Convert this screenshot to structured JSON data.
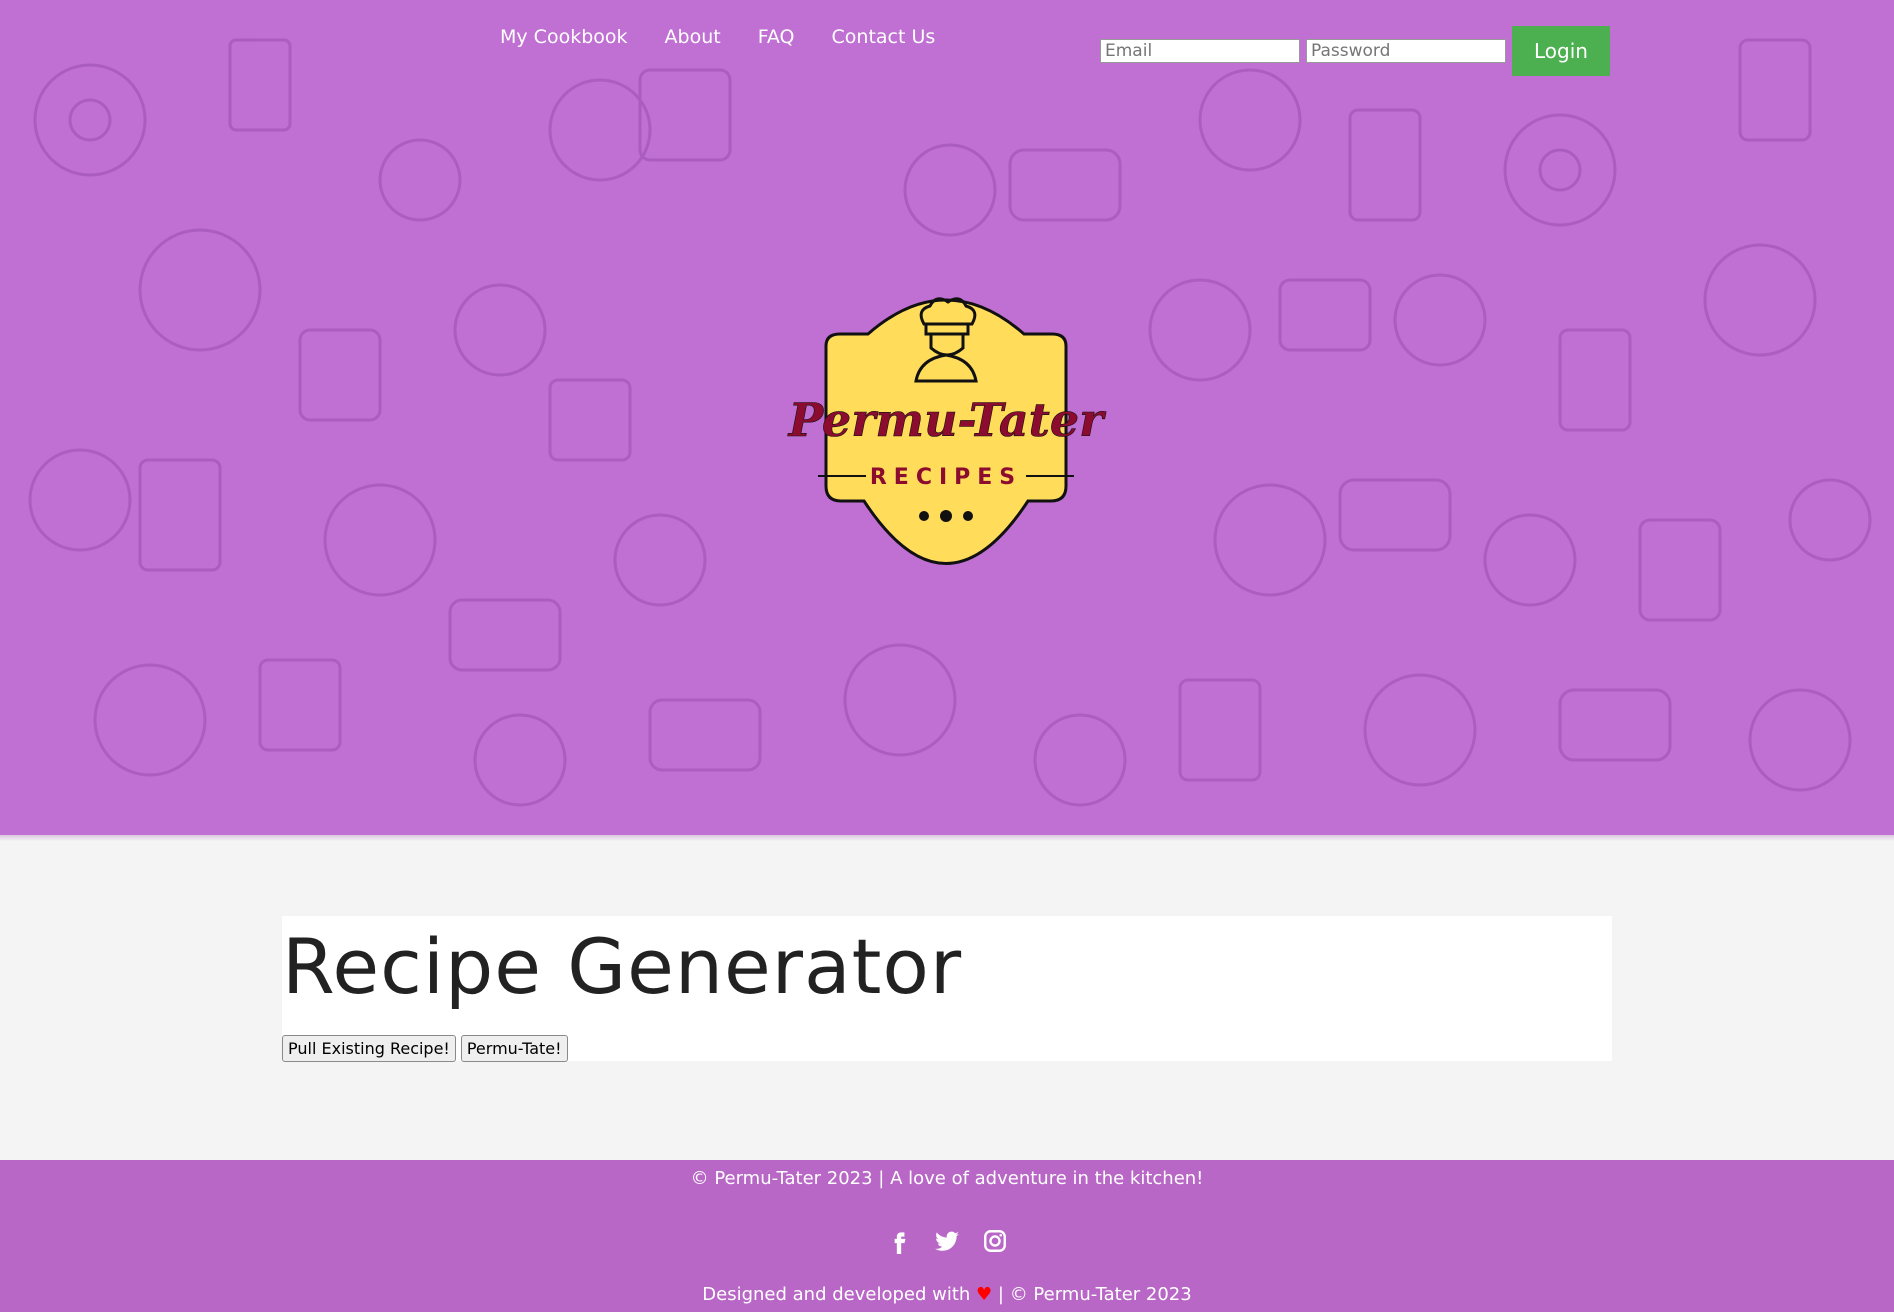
{
  "nav": {
    "items": [
      "My Cookbook",
      "About",
      "FAQ",
      "Contact Us"
    ]
  },
  "login": {
    "email_placeholder": "Email",
    "password_placeholder": "Password",
    "button_label": "Login"
  },
  "logo": {
    "brand": "Permu-Tater",
    "tagline": "RECIPES"
  },
  "main": {
    "title": "Recipe Generator",
    "buttons": [
      "Pull Existing Recipe!",
      "Permu-Tate!"
    ]
  },
  "footer": {
    "copyright": "© Permu-Tater 2023 | A love of adventure in the kitchen!",
    "credit_prefix": "Designed and developed with",
    "credit_heart": "♥",
    "credit_suffix": "| © Permu-Tater 2023",
    "social_icons": [
      "facebook-icon",
      "twitter-icon",
      "instagram-icon"
    ]
  },
  "colors": {
    "hero_bg": "#c06fd3",
    "footer_bg": "#b967c7",
    "login_button": "#4caf50",
    "logo_fill": "#ffdc5a",
    "logo_text": "#8b0c2e"
  }
}
